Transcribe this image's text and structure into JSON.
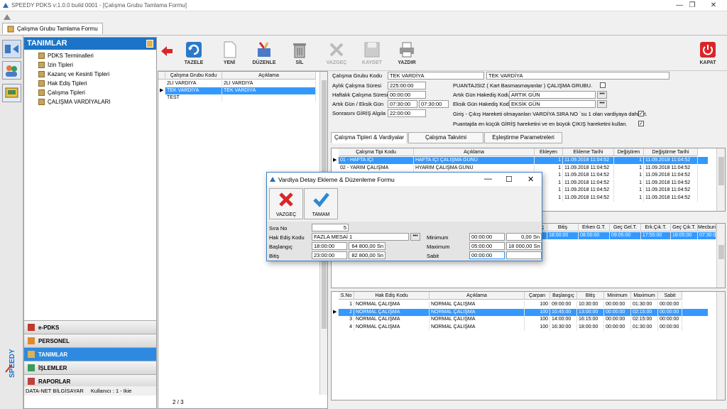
{
  "window": {
    "title": "SPEEDY PDKS v:1.0.0 build 0001 - [Çalışma Grubu Tamlama Formu]",
    "controls": [
      "—",
      "❐",
      "✕"
    ]
  },
  "doc_tab": {
    "label": "Çalışma Grubu Tamlama Formu"
  },
  "left_panel": {
    "header": "TANIMLAR",
    "tree_items": [
      {
        "label": "PDKS Terminalleri"
      },
      {
        "label": "İzin Tipleri"
      },
      {
        "label": "Kazanç ve Kesinti Tipleri"
      },
      {
        "label": "Hak Ediş Tipleri"
      },
      {
        "label": "Çalışma Tipleri"
      },
      {
        "label": "ÇALIŞMA VARDİYALARI"
      }
    ],
    "nav_buttons": [
      {
        "label": "e-PDKS"
      },
      {
        "label": "PERSONEL"
      },
      {
        "label": "TANIMLAR"
      },
      {
        "label": "İŞLEMLER"
      },
      {
        "label": "RAPORLAR"
      }
    ],
    "status_left": "DATA-NET BİLGİSAYAR",
    "status_right": "Kullanıcı : 1 - Ikie",
    "brand": "SPEEDY"
  },
  "toolbar": {
    "tazele": "TAZELE",
    "yeni": "YENİ",
    "duzenle": "DÜZENLE",
    "sil": "SİL",
    "vazgec": "VAZGEÇ",
    "kaydet": "KAYDET",
    "yazdir": "YAZDIR",
    "kapat": "KAPAT"
  },
  "group_grid": {
    "headers": [
      "Çalışma Grubu Kodu",
      "Açıklama"
    ],
    "rows": [
      {
        "kod": "2Lİ VARDİYA",
        "aciklama": "2Lİ VARDİYA"
      },
      {
        "kod": "TEK VARDİYA",
        "aciklama": "TEK VARDİYA"
      },
      {
        "kod": "TEST",
        "aciklama": ""
      }
    ],
    "pager": "2 / 3"
  },
  "form": {
    "kod_label": "Çalışma Grubu Kodu",
    "kod_value": "TEK VARDİYA",
    "aciklama_value": "TEK VARDİYA",
    "aylik_label": "Aylık Çalışma Süresi",
    "aylik_value": "225:00:00",
    "haftalik_label": "Haftalık Çalışma Süresi",
    "haftalik_value": "00:00:00",
    "artik_label": "Artık Gün / Eksik Gün",
    "artik_value": "07:30:00",
    "eksik_value": "07:30:00",
    "sonrasini_label": "Sonrasını GİRİŞ Algıla",
    "sonrasini_value": "22:00:00",
    "puantajsiz_label": "PUANTAJSIZ ( Kart Basmasmayanlar )  ÇALIŞMA GRUBU.",
    "artik_hak_label": "Artık Gün Hakediş Kodu",
    "artik_hak_value": "ARTIK GÜN",
    "eksik_hak_label": "Eksik Gün Hakediş Kodu",
    "eksik_hak_value": "EKSİK GÜN",
    "giris_cikis_label": "Giriş - Çıkış Hareketi olmayanları VARDİYA SIRA NO `su 1 olan vardiyaya dahil et.",
    "puantaj_label": "Puantajda en küçük GİRİŞ hareketini ve en büyük ÇIKIŞ hareketini kullan.",
    "dots": "•••"
  },
  "subtabs": [
    "Çalışma Tipleri & Vardiyalar",
    "Çalışma Takvimi",
    "Eşleştirme Parametreleri"
  ],
  "shift_grid": {
    "headers": [
      "Çalışma Tipi Kodu",
      "Açıklama",
      "Ekleyen",
      "Ekleme Tarihi",
      "Değiştiren",
      "Değiştirme Tarihi"
    ],
    "rows": [
      {
        "kod": "01 - HAFTA İÇİ",
        "aciklama": "HAFTA İÇİ ÇALIŞMA GÜNÜ",
        "ekleyen": "1",
        "tarih": "11.09.2018 11:04:52",
        "degistiren": "1",
        "dtarih": "11.09.2018 11:04:52"
      },
      {
        "kod": "02 - YARIM ÇALIŞMA",
        "aciklama": "HYARIM ÇALIŞMA GÜNÜ",
        "ekleyen": "1",
        "tarih": "11.09.2018 11:04:52",
        "degistiren": "1",
        "dtarih": "11.09.2018 11:04:52"
      },
      {
        "kod": "",
        "aciklama": "",
        "ekleyen": "1",
        "tarih": "11.09.2018 11:04:52",
        "degistiren": "1",
        "dtarih": "11.09.2018 11:04:52"
      },
      {
        "kod": "",
        "aciklama": "",
        "ekleyen": "1",
        "tarih": "11.09.2018 11:04:52",
        "degistiren": "1",
        "dtarih": "11.09.2018 11:04:52"
      },
      {
        "kod": "",
        "aciklama": "",
        "ekleyen": "1",
        "tarih": "11.09.2018 11:04:52",
        "degistiren": "1",
        "dtarih": "11.09.2018 11:04:52"
      },
      {
        "kod": "",
        "aciklama": "",
        "ekleyen": "1",
        "tarih": "11.09.2018 11:04:52",
        "degistiren": "1",
        "dtarih": "11.09.2018 11:04:52"
      }
    ]
  },
  "vardiya_grid": {
    "headers": [
      "ıç",
      "Bitiş",
      "Erken G.T.",
      "Geç Gel.T.",
      "Erk.Çık.T.",
      "Geç Çık.T.",
      "Mecburi"
    ],
    "row": [
      "",
      "18:00:00",
      "08:00:00",
      "09:05:00",
      "17:55:00",
      "18:05:00",
      "07:30:0"
    ]
  },
  "hakedis_grid": {
    "headers": [
      "S.No",
      "Hak Ediş Kodu",
      "Açıklama",
      "Çarpan",
      "Başlangıç",
      "Bitiş",
      "Minimum",
      "Maximum",
      "Sabit"
    ],
    "rows": [
      {
        "sno": "1",
        "kod": "NORMAL ÇALIŞMA",
        "aciklama": "NORMAL ÇALIŞMA",
        "carpan": "100",
        "bas": "09:00:00",
        "bit": "10:30:00",
        "min": "00:00:00",
        "max": "01:30:00",
        "sabit": "00:00:00"
      },
      {
        "sno": "2",
        "kod": "NORMAL ÇALIŞMA",
        "aciklama": "NORMAL ÇALIŞMA",
        "carpan": "100",
        "bas": "10:45:00",
        "bit": "13:00:00",
        "min": "00:00:00",
        "max": "02:15:00",
        "sabit": "00:00:00"
      },
      {
        "sno": "3",
        "kod": "NORMAL ÇALIŞMA",
        "aciklama": "NORMAL ÇALIŞMA",
        "carpan": "100",
        "bas": "14:00:00",
        "bit": "16:15:00",
        "min": "00:00:00",
        "max": "02:15:00",
        "sabit": "00:00:00"
      },
      {
        "sno": "4",
        "kod": "NORMAL ÇALIŞMA",
        "aciklama": "NORMAL ÇALIŞMA",
        "carpan": "100",
        "bas": "16:30:00",
        "bit": "18:00:00",
        "min": "00:00:00",
        "max": "01:30:00",
        "sabit": "00:00:00"
      }
    ]
  },
  "dialog": {
    "title": "Vardiya Detay Ekleme & Düzenleme Formu",
    "vazgec": "VAZGEÇ",
    "tamam": "TAMAM",
    "sira_label": "Sıra No",
    "sira_value": "5",
    "hak_label": "Hak Ediş Kodu",
    "hak_value": "FAZLA MESAİ 1",
    "baslangic_label": "Başlangıç",
    "baslangic_value": "18:00:00",
    "baslangic_sn": "64 800,00 Sn",
    "bitis_label": "Bitiş",
    "bitis_value": "23:00:00",
    "bitis_sn": "82 800,00 Sn",
    "minimum_label": "Minimum",
    "minimum_value": "00:00:00",
    "minimum_sn": "0,00 Sn",
    "maximum_label": "Maximum",
    "maximum_value": "05:00:00",
    "maximum_sn": "18 000,00 Sn",
    "sabit_label": "Sabit",
    "sabit_value": "00:00:00",
    "sabit_sn": ""
  },
  "colors": {
    "accent": "#1b74c8",
    "selection": "#3399ff",
    "danger": "#d9252a",
    "confirm": "#2a8ad4"
  }
}
